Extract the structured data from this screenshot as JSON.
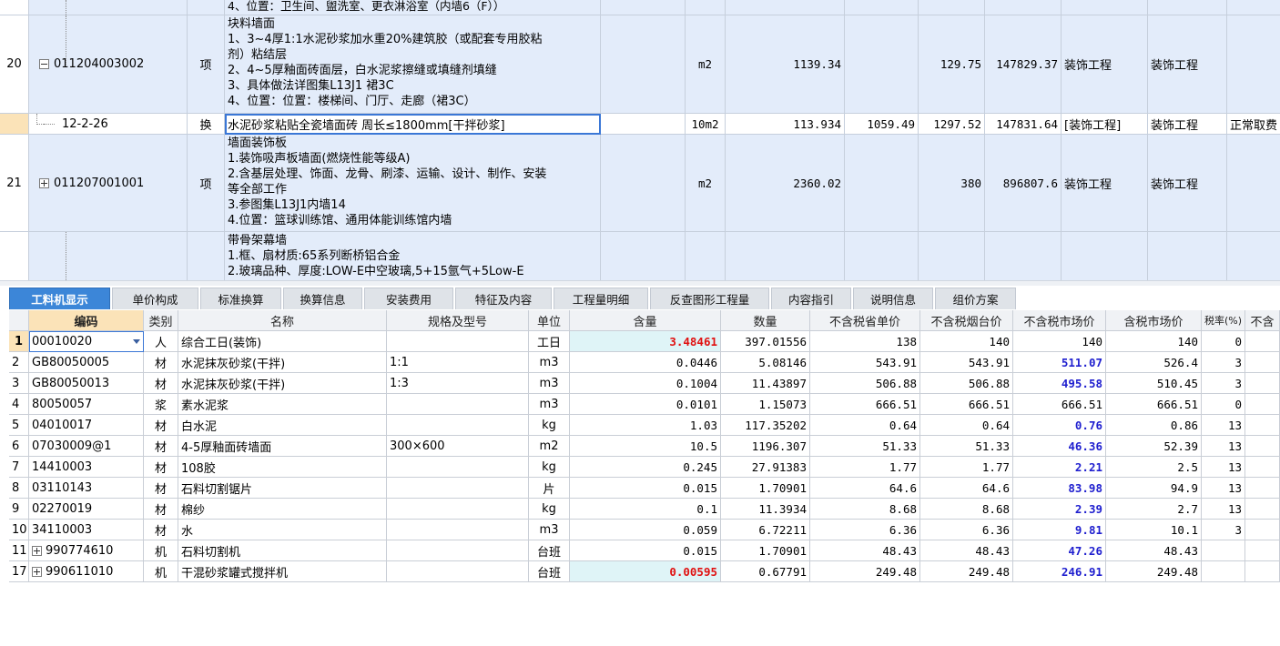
{
  "top": {
    "partial_top_text": "4、位置：卫生间、盥洗室、更衣淋浴室（内墙6（F））",
    "rows": [
      {
        "num": "20",
        "code": "011204003002",
        "expander": "minus",
        "type": "项",
        "desc_lines": [
          "块料墙面",
          "1、3~4厚1:1水泥砂浆加水重20%建筑胶（或配套专用胶粘",
          "剂）粘结层",
          "2、4~5厚釉面砖面层，白水泥浆擦缝或填缝剂填缝",
          "3、具体做法详图集L13J1 裙3C",
          "4、位置：位置：楼梯间、门厅、走廊（裙3C）"
        ],
        "unit": "m2",
        "qty": "1139.34",
        "col_a": "",
        "price": "129.75",
        "total": "147829.37",
        "major": "装饰工程",
        "major2": "装饰工程",
        "fee": ""
      },
      {
        "num": "",
        "code": "12-2-26",
        "expander": "",
        "type": "换",
        "desc_lines": [
          "水泥砂浆粘贴全瓷墙面砖 周长≤1800mm[干拌砂浆]"
        ],
        "unit": "10m2",
        "qty": "113.934",
        "col_a": "1059.49",
        "price": "1297.52",
        "total": "147831.64",
        "major": "[装饰工程]",
        "major2": "装饰工程",
        "fee": "正常取费"
      },
      {
        "num": "21",
        "code": "011207001001",
        "expander": "plus",
        "type": "项",
        "desc_lines": [
          "墙面装饰板",
          "1.装饰吸声板墙面(燃烧性能等级A)",
          "2.含基层处理、饰面、龙骨、刷漆、运输、设计、制作、安装",
          "等全部工作",
          "3.参图集L13J1内墙14",
          "4.位置：篮球训练馆、通用体能训练馆内墙"
        ],
        "unit": "m2",
        "qty": "2360.02",
        "col_a": "",
        "price": "380",
        "total": "896807.6",
        "major": "装饰工程",
        "major2": "装饰工程",
        "fee": ""
      },
      {
        "num": "",
        "code": "",
        "expander": "",
        "type": "",
        "desc_lines": [
          "带骨架幕墙",
          "1.框、扇材质:65系列断桥铝合金",
          "2.玻璃品种、厚度:LOW-E中空玻璃,5+15氩气+5Low-E"
        ],
        "unit": "",
        "qty": "",
        "col_a": "",
        "price": "",
        "total": "",
        "major": "",
        "major2": "",
        "fee": ""
      }
    ]
  },
  "tabs": [
    "工料机显示",
    "单价构成",
    "标准换算",
    "换算信息",
    "安装费用",
    "特征及内容",
    "工程量明细",
    "反查图形工程量",
    "内容指引",
    "说明信息",
    "组价方案"
  ],
  "active_tab": 0,
  "grid": {
    "headers": [
      "编码",
      "类别",
      "名称",
      "规格及型号",
      "单位",
      "含量",
      "数量",
      "不含税省单价",
      "不含税烟台价",
      "不含税市场价",
      "含税市场价",
      "税率(%)",
      "不含"
    ],
    "rows": [
      {
        "rn": "1",
        "code": "00010020",
        "cat": "人",
        "name": "综合工日(装饰)",
        "spec": "",
        "unit": "工日",
        "content": "3.48461",
        "qty": "397.01556",
        "prov": "138",
        "yt": "140",
        "mkt": "140",
        "mkt_tax": "140",
        "rate": "0",
        "exp": ""
      },
      {
        "rn": "2",
        "code": "GB80050005",
        "cat": "材",
        "name": "水泥抹灰砂浆(干拌)",
        "spec": "1:1",
        "unit": "m3",
        "content": "0.0446",
        "qty": "5.08146",
        "prov": "543.91",
        "yt": "543.91",
        "mkt": "511.07",
        "mkt_tax": "526.4",
        "rate": "3",
        "exp": ""
      },
      {
        "rn": "3",
        "code": "GB80050013",
        "cat": "材",
        "name": "水泥抹灰砂浆(干拌)",
        "spec": "1:3",
        "unit": "m3",
        "content": "0.1004",
        "qty": "11.43897",
        "prov": "506.88",
        "yt": "506.88",
        "mkt": "495.58",
        "mkt_tax": "510.45",
        "rate": "3",
        "exp": ""
      },
      {
        "rn": "4",
        "code": "80050057",
        "cat": "浆",
        "name": "素水泥浆",
        "spec": "",
        "unit": "m3",
        "content": "0.0101",
        "qty": "1.15073",
        "prov": "666.51",
        "yt": "666.51",
        "mkt": "666.51",
        "mkt_tax": "666.51",
        "rate": "0",
        "exp": ""
      },
      {
        "rn": "5",
        "code": "04010017",
        "cat": "材",
        "name": "白水泥",
        "spec": "",
        "unit": "kg",
        "content": "1.03",
        "qty": "117.35202",
        "prov": "0.64",
        "yt": "0.64",
        "mkt": "0.76",
        "mkt_tax": "0.86",
        "rate": "13",
        "exp": ""
      },
      {
        "rn": "6",
        "code": "07030009@1",
        "cat": "材",
        "name": "4-5厚釉面砖墙面",
        "spec": "300×600",
        "unit": "m2",
        "content": "10.5",
        "qty": "1196.307",
        "prov": "51.33",
        "yt": "51.33",
        "mkt": "46.36",
        "mkt_tax": "52.39",
        "rate": "13",
        "exp": ""
      },
      {
        "rn": "7",
        "code": "14410003",
        "cat": "材",
        "name": "108胶",
        "spec": "",
        "unit": "kg",
        "content": "0.245",
        "qty": "27.91383",
        "prov": "1.77",
        "yt": "1.77",
        "mkt": "2.21",
        "mkt_tax": "2.5",
        "rate": "13",
        "exp": ""
      },
      {
        "rn": "8",
        "code": "03110143",
        "cat": "材",
        "name": "石料切割锯片",
        "spec": "",
        "unit": "片",
        "content": "0.015",
        "qty": "1.70901",
        "prov": "64.6",
        "yt": "64.6",
        "mkt": "83.98",
        "mkt_tax": "94.9",
        "rate": "13",
        "exp": ""
      },
      {
        "rn": "9",
        "code": "02270019",
        "cat": "材",
        "name": "棉纱",
        "spec": "",
        "unit": "kg",
        "content": "0.1",
        "qty": "11.3934",
        "prov": "8.68",
        "yt": "8.68",
        "mkt": "2.39",
        "mkt_tax": "2.7",
        "rate": "13",
        "exp": ""
      },
      {
        "rn": "10",
        "code": "34110003",
        "cat": "材",
        "name": "水",
        "spec": "",
        "unit": "m3",
        "content": "0.059",
        "qty": "6.72211",
        "prov": "6.36",
        "yt": "6.36",
        "mkt": "9.81",
        "mkt_tax": "10.1",
        "rate": "3",
        "exp": ""
      },
      {
        "rn": "11",
        "code": "990774610",
        "cat": "机",
        "name": "石料切割机",
        "spec": "",
        "unit": "台班",
        "content": "0.015",
        "qty": "1.70901",
        "prov": "48.43",
        "yt": "48.43",
        "mkt": "47.26",
        "mkt_tax": "48.43",
        "rate": "",
        "exp": "plus"
      },
      {
        "rn": "17",
        "code": "990611010",
        "cat": "机",
        "name": "干混砂浆罐式搅拌机",
        "spec": "",
        "unit": "台班",
        "content": "0.00595",
        "qty": "0.67791",
        "prov": "249.48",
        "yt": "249.48",
        "mkt": "246.91",
        "mkt_tax": "249.48",
        "rate": "",
        "exp": "plus"
      }
    ]
  },
  "colors": {
    "row_blue": "#e3ecfa",
    "active_tab": "#3c86d8",
    "selected_header": "#fbe3b8",
    "market_price_text": "#1f1fcf",
    "edited_content_text": "#e01010",
    "content_cell_bg": "#dff4f7"
  }
}
